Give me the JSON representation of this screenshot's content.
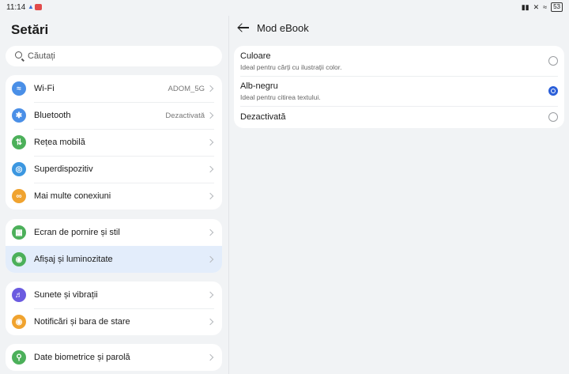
{
  "status_bar": {
    "time": "11:14",
    "battery": "53"
  },
  "left": {
    "title": "Setări",
    "search_placeholder": "Căutați",
    "groups": [
      [
        {
          "label": "Wi-Fi",
          "value": "ADOM_5G",
          "icon": "wifi-icon",
          "color": "#4a8fe7"
        },
        {
          "label": "Bluetooth",
          "value": "Dezactivată",
          "icon": "bluetooth-icon",
          "color": "#4a8fe7"
        },
        {
          "label": "Rețea mobilă",
          "value": "",
          "icon": "mobile-network-icon",
          "color": "#4cb05a"
        },
        {
          "label": "Superdispozitiv",
          "value": "",
          "icon": "superdevice-icon",
          "color": "#3c97e0"
        },
        {
          "label": "Mai multe conexiuni",
          "value": "",
          "icon": "link-icon",
          "color": "#f0a32f"
        }
      ],
      [
        {
          "label": "Ecran de pornire și stil",
          "value": "",
          "icon": "wallpaper-icon",
          "color": "#4cb05a"
        },
        {
          "label": "Afișaj și luminozitate",
          "value": "",
          "icon": "eye-icon",
          "color": "#4cb05a"
        }
      ],
      [
        {
          "label": "Sunete și vibrații",
          "value": "",
          "icon": "sound-icon",
          "color": "#6b5be0"
        },
        {
          "label": "Notificări și bara de stare",
          "value": "",
          "icon": "bell-icon",
          "color": "#f0a32f"
        }
      ],
      [
        {
          "label": "Date biometrice și parolă",
          "value": "",
          "icon": "key-icon",
          "color": "#4cb05a"
        }
      ]
    ]
  },
  "right": {
    "title": "Mod eBook",
    "options": [
      {
        "title": "Culoare",
        "subtitle": "Ideal pentru cărți cu ilustrații color.",
        "selected": false
      },
      {
        "title": "Alb-negru",
        "subtitle": "Ideal pentru citirea textului.",
        "selected": true
      },
      {
        "title": "Dezactivată",
        "subtitle": "",
        "selected": false
      }
    ]
  },
  "colors": {
    "accent": "#2b5fd9",
    "selected_row": "#e3edfb"
  }
}
